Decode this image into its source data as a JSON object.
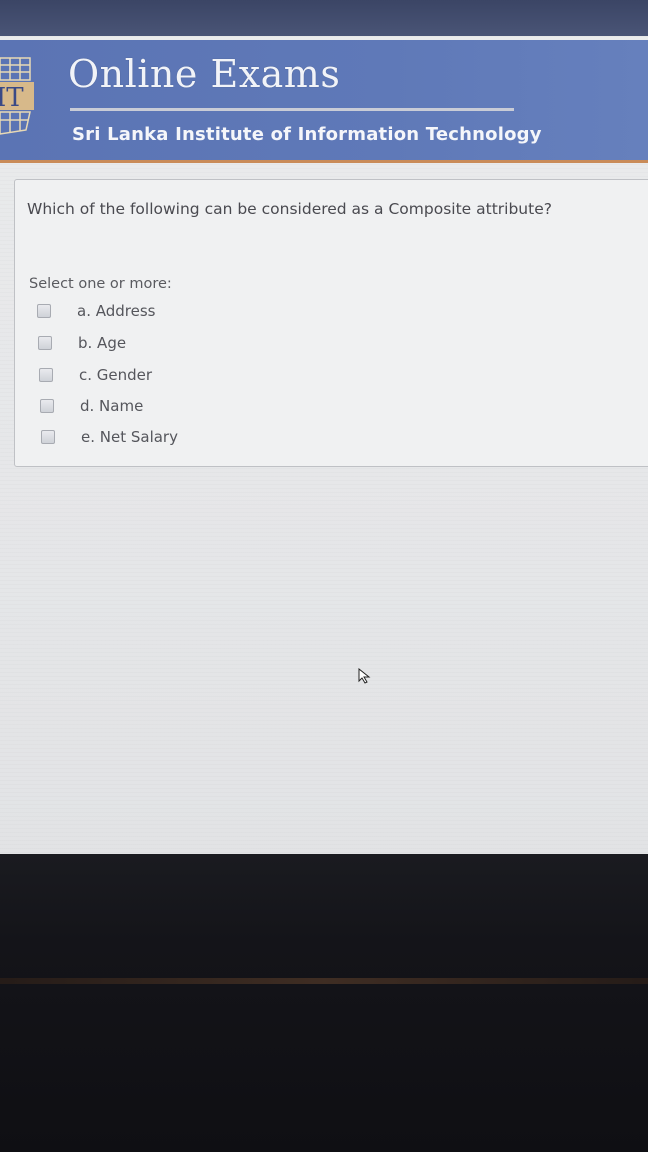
{
  "header": {
    "title": "Online Exams",
    "subtitle": "Sri Lanka Institute of Information Technology",
    "logo_text": "IT"
  },
  "question": {
    "text": "Which of the following can be considered as a Composite attribute?",
    "prompt": "Select one or more:",
    "options": [
      {
        "label": "a. Address",
        "checked": false
      },
      {
        "label": "b. Age",
        "checked": false
      },
      {
        "label": "c. Gender",
        "checked": false
      },
      {
        "label": "d. Name",
        "checked": false
      },
      {
        "label": "e. Net Salary",
        "checked": false
      }
    ]
  },
  "colors": {
    "header_bg": "#5f79b8",
    "header_accent": "#c98b58",
    "page_bg": "#e8e9eb"
  },
  "icons": {
    "cursor": "mouse-pointer-icon"
  }
}
